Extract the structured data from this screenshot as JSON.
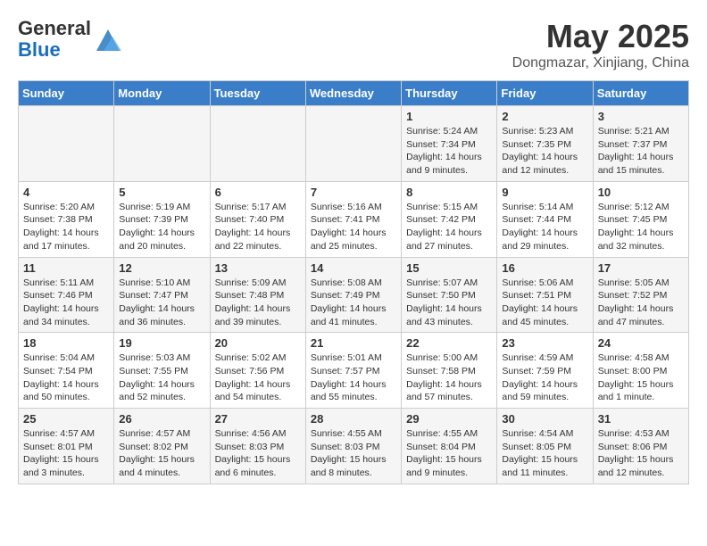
{
  "header": {
    "logo_line1": "General",
    "logo_line2": "Blue",
    "month_year": "May 2025",
    "location": "Dongmazar, Xinjiang, China"
  },
  "days_of_week": [
    "Sunday",
    "Monday",
    "Tuesday",
    "Wednesday",
    "Thursday",
    "Friday",
    "Saturday"
  ],
  "weeks": [
    [
      {
        "day": "",
        "info": ""
      },
      {
        "day": "",
        "info": ""
      },
      {
        "day": "",
        "info": ""
      },
      {
        "day": "",
        "info": ""
      },
      {
        "day": "1",
        "info": "Sunrise: 5:24 AM\nSunset: 7:34 PM\nDaylight: 14 hours\nand 9 minutes."
      },
      {
        "day": "2",
        "info": "Sunrise: 5:23 AM\nSunset: 7:35 PM\nDaylight: 14 hours\nand 12 minutes."
      },
      {
        "day": "3",
        "info": "Sunrise: 5:21 AM\nSunset: 7:37 PM\nDaylight: 14 hours\nand 15 minutes."
      }
    ],
    [
      {
        "day": "4",
        "info": "Sunrise: 5:20 AM\nSunset: 7:38 PM\nDaylight: 14 hours\nand 17 minutes."
      },
      {
        "day": "5",
        "info": "Sunrise: 5:19 AM\nSunset: 7:39 PM\nDaylight: 14 hours\nand 20 minutes."
      },
      {
        "day": "6",
        "info": "Sunrise: 5:17 AM\nSunset: 7:40 PM\nDaylight: 14 hours\nand 22 minutes."
      },
      {
        "day": "7",
        "info": "Sunrise: 5:16 AM\nSunset: 7:41 PM\nDaylight: 14 hours\nand 25 minutes."
      },
      {
        "day": "8",
        "info": "Sunrise: 5:15 AM\nSunset: 7:42 PM\nDaylight: 14 hours\nand 27 minutes."
      },
      {
        "day": "9",
        "info": "Sunrise: 5:14 AM\nSunset: 7:44 PM\nDaylight: 14 hours\nand 29 minutes."
      },
      {
        "day": "10",
        "info": "Sunrise: 5:12 AM\nSunset: 7:45 PM\nDaylight: 14 hours\nand 32 minutes."
      }
    ],
    [
      {
        "day": "11",
        "info": "Sunrise: 5:11 AM\nSunset: 7:46 PM\nDaylight: 14 hours\nand 34 minutes."
      },
      {
        "day": "12",
        "info": "Sunrise: 5:10 AM\nSunset: 7:47 PM\nDaylight: 14 hours\nand 36 minutes."
      },
      {
        "day": "13",
        "info": "Sunrise: 5:09 AM\nSunset: 7:48 PM\nDaylight: 14 hours\nand 39 minutes."
      },
      {
        "day": "14",
        "info": "Sunrise: 5:08 AM\nSunset: 7:49 PM\nDaylight: 14 hours\nand 41 minutes."
      },
      {
        "day": "15",
        "info": "Sunrise: 5:07 AM\nSunset: 7:50 PM\nDaylight: 14 hours\nand 43 minutes."
      },
      {
        "day": "16",
        "info": "Sunrise: 5:06 AM\nSunset: 7:51 PM\nDaylight: 14 hours\nand 45 minutes."
      },
      {
        "day": "17",
        "info": "Sunrise: 5:05 AM\nSunset: 7:52 PM\nDaylight: 14 hours\nand 47 minutes."
      }
    ],
    [
      {
        "day": "18",
        "info": "Sunrise: 5:04 AM\nSunset: 7:54 PM\nDaylight: 14 hours\nand 50 minutes."
      },
      {
        "day": "19",
        "info": "Sunrise: 5:03 AM\nSunset: 7:55 PM\nDaylight: 14 hours\nand 52 minutes."
      },
      {
        "day": "20",
        "info": "Sunrise: 5:02 AM\nSunset: 7:56 PM\nDaylight: 14 hours\nand 54 minutes."
      },
      {
        "day": "21",
        "info": "Sunrise: 5:01 AM\nSunset: 7:57 PM\nDaylight: 14 hours\nand 55 minutes."
      },
      {
        "day": "22",
        "info": "Sunrise: 5:00 AM\nSunset: 7:58 PM\nDaylight: 14 hours\nand 57 minutes."
      },
      {
        "day": "23",
        "info": "Sunrise: 4:59 AM\nSunset: 7:59 PM\nDaylight: 14 hours\nand 59 minutes."
      },
      {
        "day": "24",
        "info": "Sunrise: 4:58 AM\nSunset: 8:00 PM\nDaylight: 15 hours\nand 1 minute."
      }
    ],
    [
      {
        "day": "25",
        "info": "Sunrise: 4:57 AM\nSunset: 8:01 PM\nDaylight: 15 hours\nand 3 minutes."
      },
      {
        "day": "26",
        "info": "Sunrise: 4:57 AM\nSunset: 8:02 PM\nDaylight: 15 hours\nand 4 minutes."
      },
      {
        "day": "27",
        "info": "Sunrise: 4:56 AM\nSunset: 8:03 PM\nDaylight: 15 hours\nand 6 minutes."
      },
      {
        "day": "28",
        "info": "Sunrise: 4:55 AM\nSunset: 8:03 PM\nDaylight: 15 hours\nand 8 minutes."
      },
      {
        "day": "29",
        "info": "Sunrise: 4:55 AM\nSunset: 8:04 PM\nDaylight: 15 hours\nand 9 minutes."
      },
      {
        "day": "30",
        "info": "Sunrise: 4:54 AM\nSunset: 8:05 PM\nDaylight: 15 hours\nand 11 minutes."
      },
      {
        "day": "31",
        "info": "Sunrise: 4:53 AM\nSunset: 8:06 PM\nDaylight: 15 hours\nand 12 minutes."
      }
    ]
  ]
}
